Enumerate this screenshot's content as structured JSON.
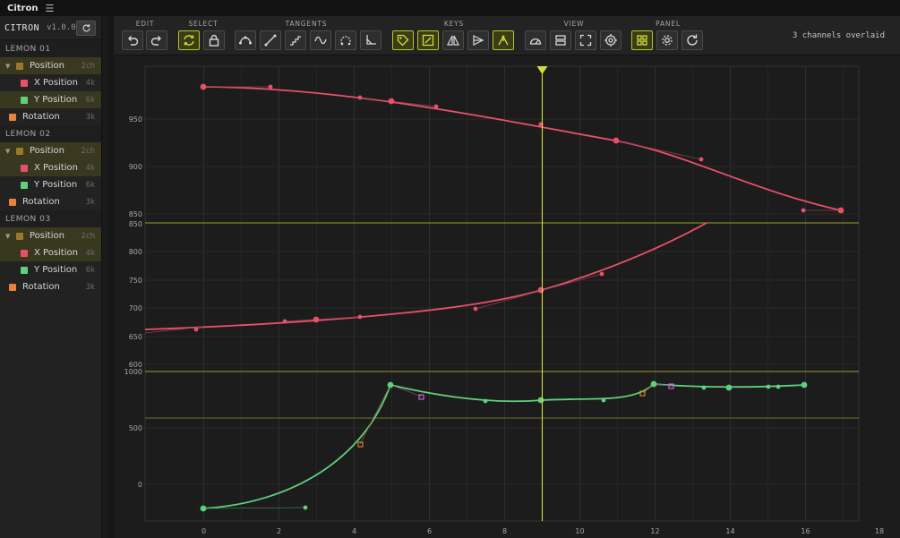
{
  "app": {
    "name": "Citron"
  },
  "sidebar": {
    "brand": "CITRON",
    "version": "v1.0.0",
    "groups": [
      {
        "name": "LEMON 01",
        "position": {
          "label": "Position",
          "count": "2ch"
        },
        "x": {
          "label": "X Position",
          "count": "4k"
        },
        "y": {
          "label": "Y Position",
          "count": "6k"
        },
        "rotation": {
          "label": "Rotation",
          "count": "3k"
        }
      },
      {
        "name": "LEMON 02",
        "position": {
          "label": "Position",
          "count": "2ch"
        },
        "x": {
          "label": "X Position",
          "count": "4k"
        },
        "y": {
          "label": "Y Position",
          "count": "6k"
        },
        "rotation": {
          "label": "Rotation",
          "count": "3k"
        }
      },
      {
        "name": "LEMON 03",
        "position": {
          "label": "Position",
          "count": "2ch"
        },
        "x": {
          "label": "X Position",
          "count": "4k"
        },
        "y": {
          "label": "Y Position",
          "count": "6k"
        },
        "rotation": {
          "label": "Rotation",
          "count": "3k"
        }
      }
    ]
  },
  "toolbar": {
    "sections": {
      "edit": "EDIT",
      "select": "SELECT",
      "tangents": "TANGENTS",
      "keys": "KEYS",
      "view": "VIEW",
      "panel": "PANEL"
    },
    "status": "3 channels overlaid"
  },
  "colors": {
    "x_channel": "#e8506a",
    "y_channel": "#5fd17e",
    "position": "#9a7a2a",
    "rotation": "#e8843a",
    "accent": "#c9d335"
  },
  "graph": {
    "x_ticks": [
      "0",
      "2",
      "4",
      "6",
      "8",
      "10",
      "12",
      "14",
      "16",
      "18"
    ],
    "lanes": [
      {
        "ticks": [
          "950",
          "900",
          "850"
        ]
      },
      {
        "ticks": [
          "850",
          "800",
          "750",
          "700",
          "650",
          "600"
        ]
      },
      {
        "ticks": [
          "1000",
          "500",
          "0"
        ]
      }
    ],
    "playhead_time": 9
  }
}
